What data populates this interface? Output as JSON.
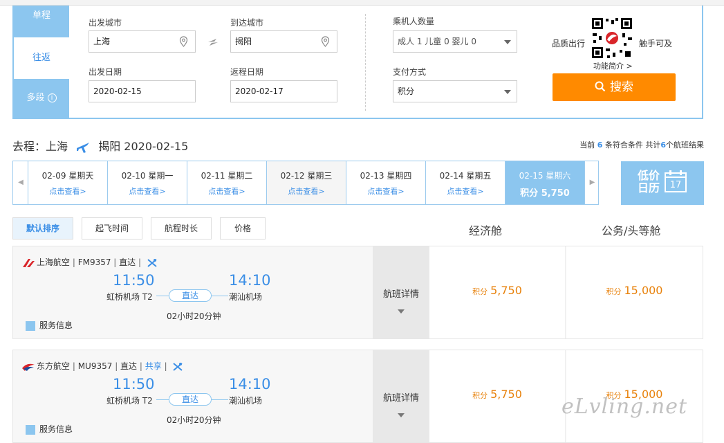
{
  "tabs": {
    "oneway": "单程",
    "roundtrip": "往返",
    "multi": "多段",
    "multi_info": "i"
  },
  "form": {
    "from_label": "出发城市",
    "from_value": "上海",
    "to_label": "到达城市",
    "to_value": "揭阳",
    "depart_label": "出发日期",
    "depart_value": "2020-02-15",
    "return_label": "返程日期",
    "return_value": "2020-02-17",
    "pax_label": "乘机人数量",
    "pax_value": "成人 1  儿童 0  婴儿 0",
    "pay_label": "支付方式",
    "pay_value": "积分"
  },
  "promo": {
    "quality": "品质出行",
    "touch": "触手可及",
    "intro": "功能简介 >"
  },
  "search_button": "搜索",
  "route": {
    "prefix": "去程：上海",
    "suffix": "揭阳 2020-02-15"
  },
  "count": {
    "pre": "当前 ",
    "n1": "6",
    "mid": " 条符合条件 共计",
    "n2": "6",
    "post": "个航班结果"
  },
  "dates": [
    {
      "d": "02-09 星期天",
      "v": "点击查看>"
    },
    {
      "d": "02-10 星期一",
      "v": "点击查看>"
    },
    {
      "d": "02-11 星期二",
      "v": "点击查看>"
    },
    {
      "d": "02-12 星期三",
      "v": "点击查看>"
    },
    {
      "d": "02-13 星期四",
      "v": "点击查看>"
    },
    {
      "d": "02-14 星期五",
      "v": "点击查看>"
    },
    {
      "d": "02-15 星期六",
      "v": "积分 5,750"
    }
  ],
  "lowcal": {
    "line1": "低价",
    "line2": "日历",
    "day": "17"
  },
  "sort": {
    "default": "默认排序",
    "dep": "起飞时间",
    "dur": "航程时长",
    "price": "价格"
  },
  "cols": {
    "eco": "经济舱",
    "biz": "公务/头等舱"
  },
  "flights": [
    {
      "airline": "上海航空",
      "flight": "FM9357",
      "direct": "直达",
      "share": "",
      "dep": "11:50",
      "arr": "14:10",
      "dep_port": "虹桥机场 T2",
      "arr_port": "潮汕机场",
      "tag": "直达",
      "dur": "02小时20分钟",
      "svc": "服务信息",
      "detail": "航班详情",
      "eco_pfx": "积分",
      "eco": "5,750",
      "biz_pfx": "积分",
      "biz": "15,000"
    },
    {
      "airline": "东方航空",
      "flight": "MU9357",
      "direct": "直达",
      "share": "共享",
      "dep": "11:50",
      "arr": "14:10",
      "dep_port": "虹桥机场 T2",
      "arr_port": "潮汕机场",
      "tag": "直达",
      "dur": "02小时20分钟",
      "svc": "服务信息",
      "detail": "航班详情",
      "eco_pfx": "积分",
      "eco": "5,750",
      "biz_pfx": "积分",
      "biz": "15,000"
    }
  ],
  "watermark": "eLvling.net",
  "colors": {
    "accent": "#8cc6ef",
    "link": "#3a8ee6",
    "orange": "#ff8a00",
    "price": "#e8820c"
  }
}
